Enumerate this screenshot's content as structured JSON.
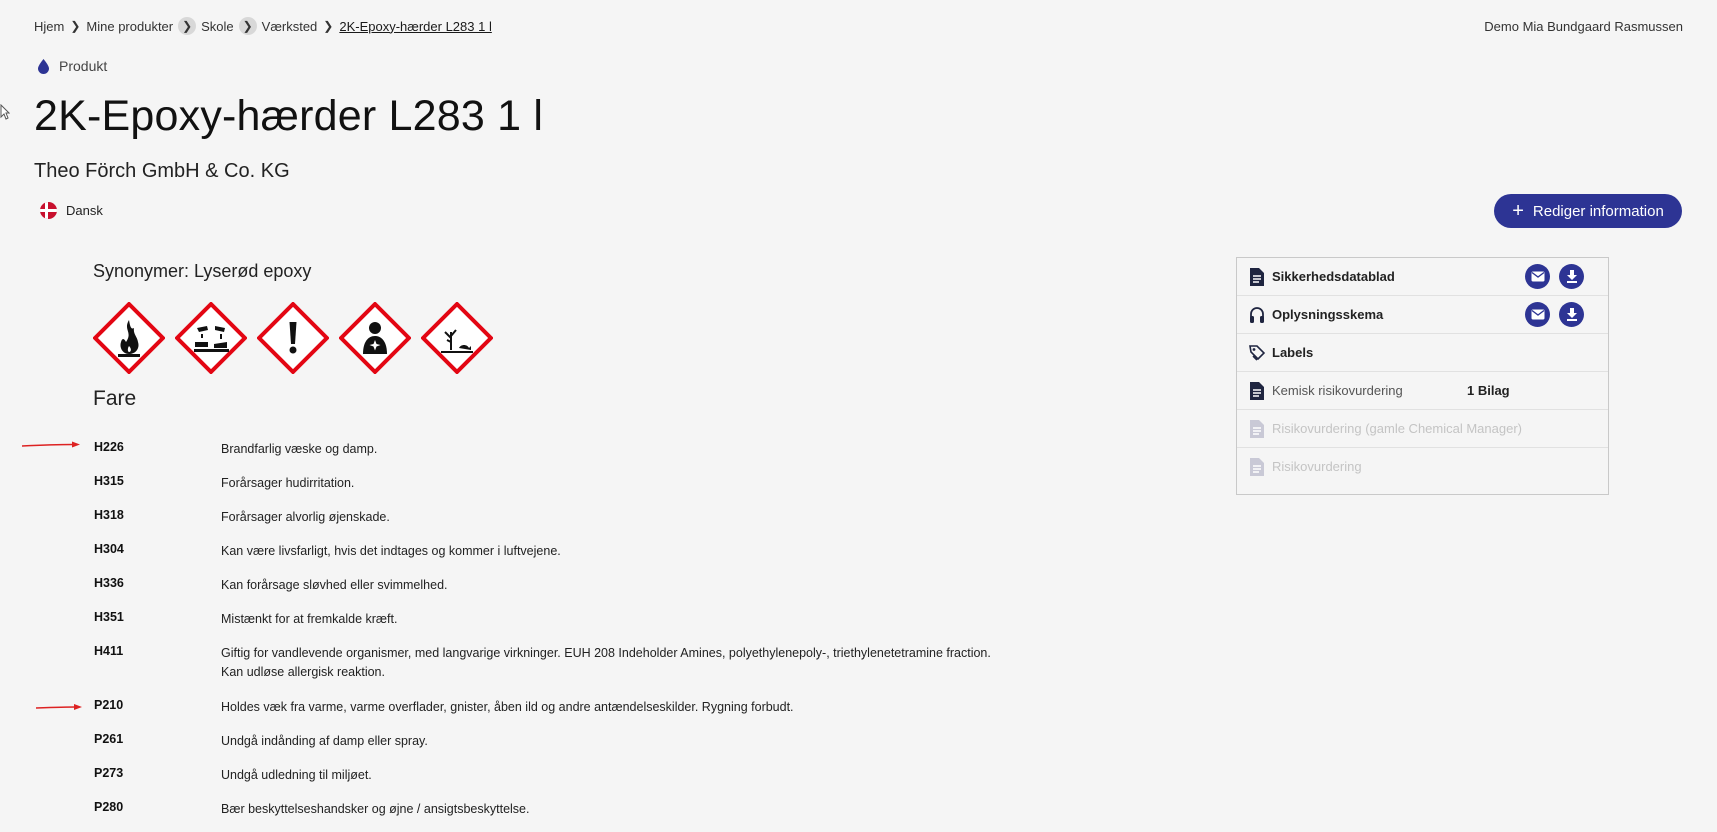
{
  "breadcrumb": {
    "items": [
      "Hjem",
      "Mine produkter",
      "Skole",
      "Værksted"
    ],
    "current": "2K-Epoxy-hærder L283 1 l"
  },
  "user": {
    "name": "Demo Mia Bundgaard Rasmussen"
  },
  "product": {
    "type_label": "Produkt",
    "title": "2K-Epoxy-hærder L283 1 l",
    "manufacturer": "Theo Förch GmbH & Co. KG",
    "language": "Dansk",
    "edit_button_label": "Rediger information",
    "synonyms": "Synonymer: Lyserød epoxy",
    "signal_word": "Fare",
    "pictograms": [
      "flame-icon",
      "corrosion-icon",
      "exclamation-icon",
      "health-hazard-icon",
      "environment-icon"
    ]
  },
  "statements": [
    {
      "code": "H226",
      "text": "Brandfarlig væske og damp."
    },
    {
      "code": "H315",
      "text": "Forårsager hudirritation."
    },
    {
      "code": "H318",
      "text": "Forårsager alvorlig øjenskade."
    },
    {
      "code": "H304",
      "text": "Kan være livsfarligt, hvis det indtages og kommer i luftvejene."
    },
    {
      "code": "H336",
      "text": "Kan forårsage sløvhed eller svimmelhed."
    },
    {
      "code": "H351",
      "text": "Mistænkt for at fremkalde kræft."
    },
    {
      "code": "H411",
      "text": "Giftig for vandlevende organismer, med langvarige virkninger. EUH 208 Indeholder Amines, polyethylenepoly-, triethylenetetramine fraction. Kan udløse allergisk reaktion."
    },
    {
      "code": "P210",
      "text": "Holdes væk fra varme, varme overflader, gnister, åben ild og andre antændelseskilder. Rygning forbudt."
    },
    {
      "code": "P261",
      "text": "Undgå indånding af damp eller spray."
    },
    {
      "code": "P273",
      "text": "Undgå udledning til miljøet."
    },
    {
      "code": "P280",
      "text": "Bær beskyttelseshandsker og øjne / ansigtsbeskyttelse."
    }
  ],
  "documents": {
    "items": [
      {
        "label": "Sikkerhedsdatablad",
        "icon": "document-icon"
      },
      {
        "label": "Oplysningsskema",
        "icon": "headphones-icon"
      },
      {
        "label": "Labels",
        "icon": "tag-icon"
      },
      {
        "label": "Kemisk risikovurdering",
        "icon": "document-icon",
        "extra": "1 Bilag"
      },
      {
        "label": "Risikovurdering (gamle Chemical Manager)",
        "icon": "document-icon"
      },
      {
        "label": "Risikovurdering",
        "icon": "document-icon"
      }
    ]
  },
  "colors": {
    "brand": "#2d3494",
    "hazard_red": "#e30613",
    "arrow": "#d22"
  }
}
